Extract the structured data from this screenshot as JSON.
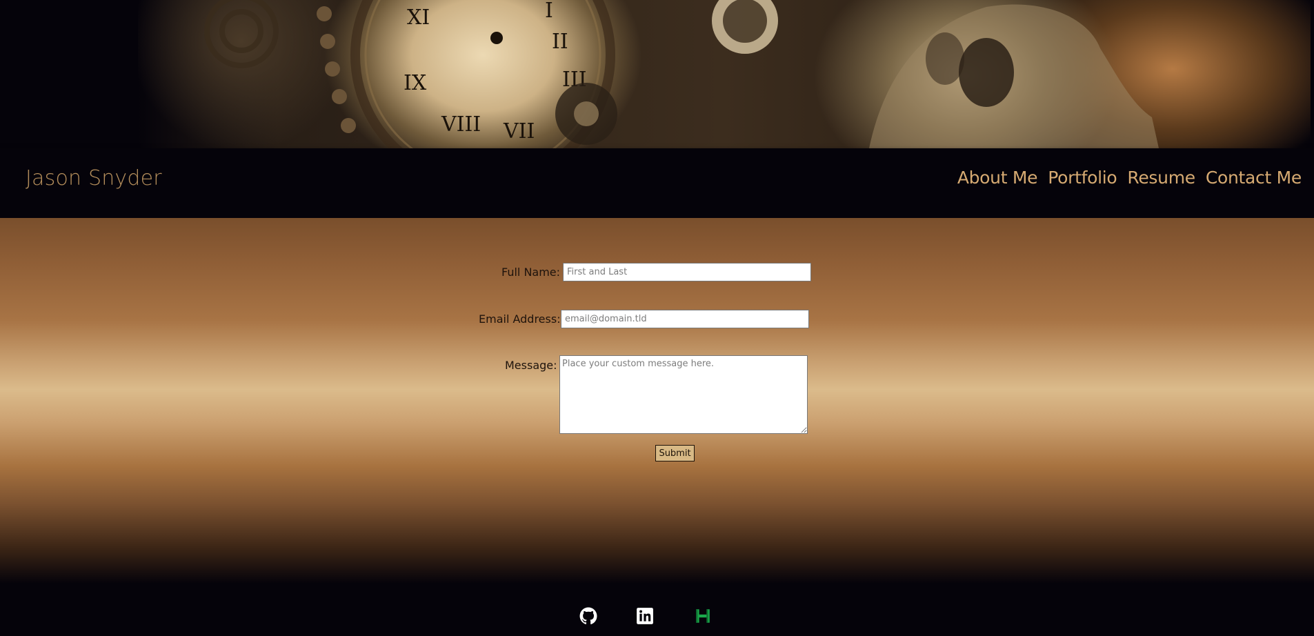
{
  "header": {
    "brand": "Jason Snyder",
    "nav": [
      "About Me",
      "Portfolio",
      "Resume",
      "Contact Me"
    ]
  },
  "form": {
    "full_name_label": "Full Name:",
    "full_name_placeholder": "First and Last",
    "email_label": "Email Address:",
    "email_placeholder": "email@domain.tld",
    "message_label": "Message:",
    "message_placeholder": "Place your custom message here.",
    "submit_label": "Submit"
  },
  "footer": {
    "icons": [
      "github-icon",
      "linkedin-icon",
      "hackerrank-icon"
    ]
  },
  "colors": {
    "brand": "#b68f5c",
    "nav_link": "#d6aa72",
    "header_bg": "#05030a",
    "hackerrank": "#1ba94c"
  }
}
